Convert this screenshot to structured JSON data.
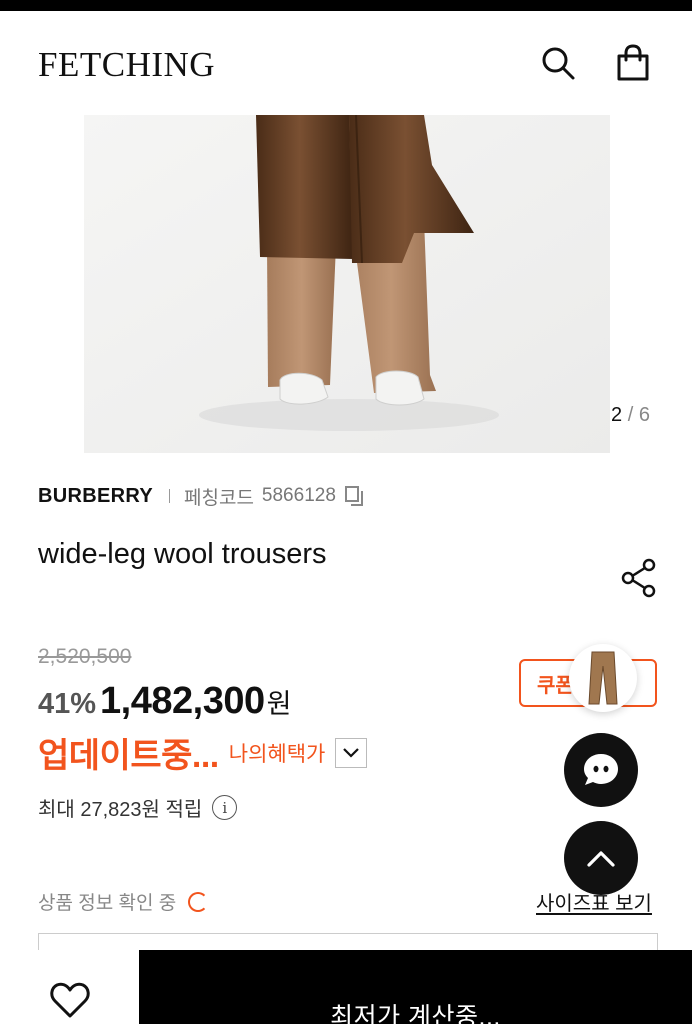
{
  "header": {
    "logo": "FETCHING",
    "search_icon": "search-icon",
    "bag_icon": "shopping-bag-icon"
  },
  "gallery": {
    "current": "2",
    "separator": "/",
    "total": "6"
  },
  "product": {
    "brand": "BURBERRY",
    "code_label": "페칭코드",
    "code_value": "5866128",
    "title": "wide-leg wool trousers"
  },
  "pricing": {
    "original_price": "2,520,500",
    "discount": "41%",
    "price": "1,482,300",
    "currency": "원",
    "updating_text": "업데이트중...",
    "benefit_label": "나의혜택가",
    "points_text": "최대 27,823원 적립",
    "info_icon_glyph": "i"
  },
  "coupon": {
    "label": "쿠폰"
  },
  "status": {
    "checking_text": "상품 정보 확인 중",
    "size_chart_label": "사이즈표 보기"
  },
  "bottom_bar": {
    "buy_label": "최저가 계산중..."
  },
  "colors": {
    "accent": "#f2541d",
    "trouser": "#b48a69",
    "coat": "#5f3b22",
    "dark_button": "#111111"
  }
}
